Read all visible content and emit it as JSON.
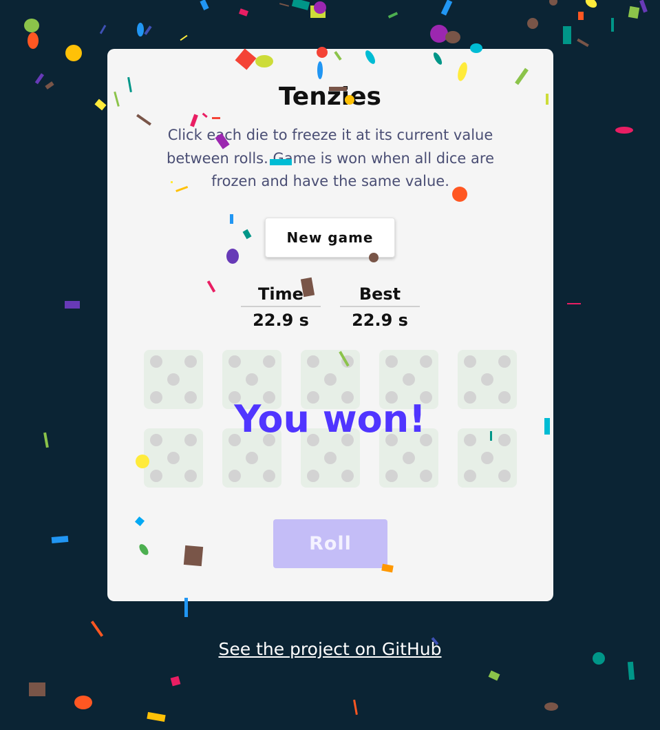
{
  "game": {
    "title": "Tenzies",
    "instructions": "Click each die to freeze it at its current value between rolls. Game is won when all dice are frozen and have the same value.",
    "new_game_label": "New game",
    "stats": {
      "time_label": "Time",
      "time_value": "22.9 s",
      "best_label": "Best",
      "best_value": "22.9 s"
    },
    "dice": [
      5,
      5,
      5,
      5,
      5,
      5,
      5,
      5,
      5,
      5
    ],
    "won_message": "You won!",
    "roll_label": "Roll"
  },
  "footer": {
    "github_link": "See the project on GitHub"
  },
  "colors": {
    "background": "#0b2434",
    "panel": "#f5f5f5",
    "accent": "#5035ff",
    "roll_disabled": "#c4bdf7",
    "die_frozen": "#dcebdc"
  }
}
